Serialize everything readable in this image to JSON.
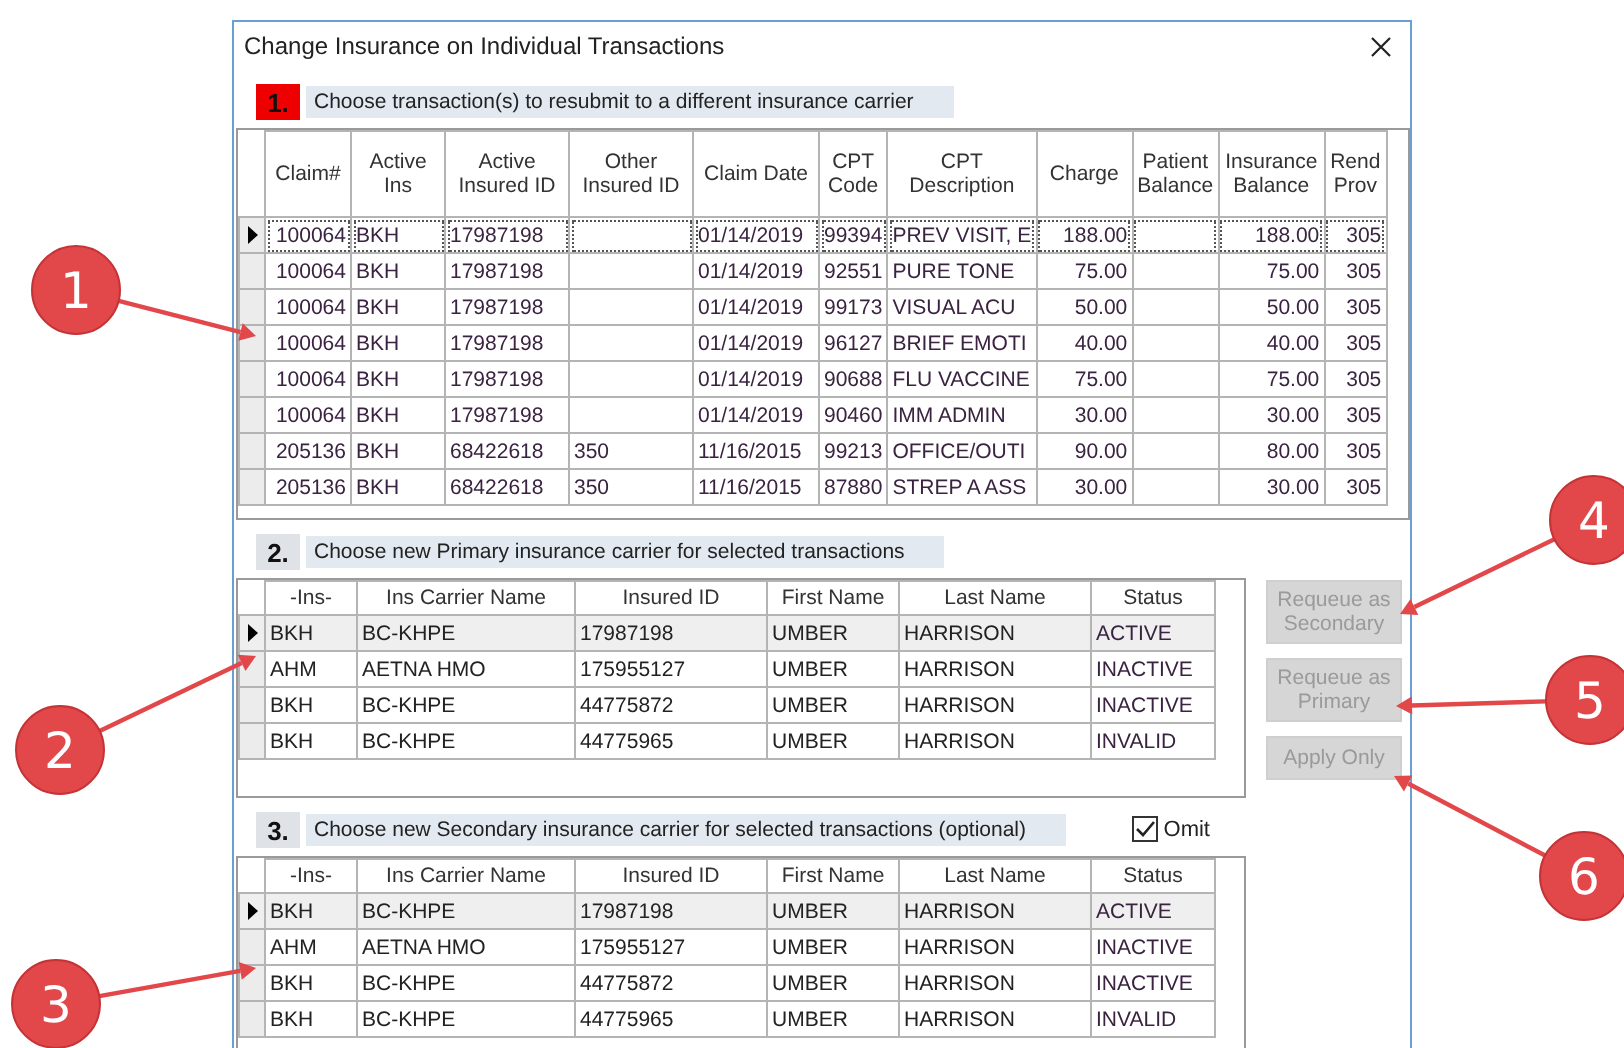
{
  "window": {
    "title": "Change Insurance on Individual Transactions"
  },
  "transactions": {
    "number": "1.",
    "highlighted": true,
    "heading": "Choose transaction(s) to resubmit to a different insurance carrier",
    "columns": [
      {
        "label": "Claim#",
        "kind": "number"
      },
      {
        "label": "Active Ins",
        "kind": "text"
      },
      {
        "label": "Active Insured ID",
        "kind": "text"
      },
      {
        "label": "Other Insured ID",
        "kind": "text"
      },
      {
        "label": "Claim Date",
        "kind": "text"
      },
      {
        "label": "CPT Code",
        "kind": "text"
      },
      {
        "label": "CPT Description",
        "kind": "text"
      },
      {
        "label": "Charge",
        "kind": "number"
      },
      {
        "label": "Patient Balance",
        "kind": "number"
      },
      {
        "label": "Insurance Balance",
        "kind": "number"
      },
      {
        "label": "Rend Prov",
        "kind": "number"
      }
    ],
    "rows": [
      {
        "selected": true,
        "cells": [
          "100064",
          "BKH",
          "17987198",
          "",
          "01/14/2019",
          "99394",
          "PREV VISIT, E",
          "188.00",
          "",
          "188.00",
          "305"
        ]
      },
      {
        "selected": false,
        "cells": [
          "100064",
          "BKH",
          "17987198",
          "",
          "01/14/2019",
          "92551",
          "PURE TONE",
          "75.00",
          "",
          "75.00",
          "305"
        ]
      },
      {
        "selected": false,
        "cells": [
          "100064",
          "BKH",
          "17987198",
          "",
          "01/14/2019",
          "99173",
          "VISUAL ACU",
          "50.00",
          "",
          "50.00",
          "305"
        ]
      },
      {
        "selected": false,
        "cells": [
          "100064",
          "BKH",
          "17987198",
          "",
          "01/14/2019",
          "96127",
          "BRIEF EMOTI",
          "40.00",
          "",
          "40.00",
          "305"
        ]
      },
      {
        "selected": false,
        "cells": [
          "100064",
          "BKH",
          "17987198",
          "",
          "01/14/2019",
          "90688",
          "FLU VACCINE",
          "75.00",
          "",
          "75.00",
          "305"
        ]
      },
      {
        "selected": false,
        "cells": [
          "100064",
          "BKH",
          "17987198",
          "",
          "01/14/2019",
          "90460",
          "IMM ADMIN",
          "30.00",
          "",
          "30.00",
          "305"
        ]
      },
      {
        "selected": false,
        "cells": [
          "205136",
          "BKH",
          "68422618",
          "350",
          "11/16/2015",
          "99213",
          "OFFICE/OUTI",
          "90.00",
          "",
          "80.00",
          "305"
        ]
      },
      {
        "selected": false,
        "cells": [
          "205136",
          "BKH",
          "68422618",
          "350",
          "11/16/2015",
          "87880",
          "STREP A ASS",
          "30.00",
          "",
          "30.00",
          "305"
        ]
      }
    ]
  },
  "primary": {
    "number": "2.",
    "highlighted": false,
    "heading": "Choose new Primary insurance carrier for selected transactions",
    "columns": [
      {
        "label": "-Ins-"
      },
      {
        "label": "Ins Carrier Name"
      },
      {
        "label": "Insured ID"
      },
      {
        "label": "First Name"
      },
      {
        "label": "Last Name"
      },
      {
        "label": "Status"
      }
    ],
    "rows": [
      {
        "selected": true,
        "cells": [
          "BKH",
          "BC-KHPE",
          "17987198",
          "UMBER",
          "HARRISON",
          "ACTIVE"
        ]
      },
      {
        "selected": false,
        "cells": [
          "AHM",
          "AETNA HMO",
          "175955127",
          "UMBER",
          "HARRISON",
          "INACTIVE"
        ]
      },
      {
        "selected": false,
        "cells": [
          "BKH",
          "BC-KHPE",
          "44775872",
          "UMBER",
          "HARRISON",
          "INACTIVE"
        ]
      },
      {
        "selected": false,
        "cells": [
          "BKH",
          "BC-KHPE",
          "44775965",
          "UMBER",
          "HARRISON",
          "INVALID"
        ]
      }
    ]
  },
  "secondary": {
    "number": "3.",
    "highlighted": false,
    "heading": "Choose new Secondary insurance carrier for selected transactions (optional)",
    "omit": {
      "label": "Omit",
      "checked": true
    },
    "columns": [
      {
        "label": "-Ins-"
      },
      {
        "label": "Ins Carrier Name"
      },
      {
        "label": "Insured ID"
      },
      {
        "label": "First Name"
      },
      {
        "label": "Last Name"
      },
      {
        "label": "Status"
      }
    ],
    "rows": [
      {
        "selected": true,
        "cells": [
          "BKH",
          "BC-KHPE",
          "17987198",
          "UMBER",
          "HARRISON",
          "ACTIVE"
        ]
      },
      {
        "selected": false,
        "cells": [
          "AHM",
          "AETNA HMO",
          "175955127",
          "UMBER",
          "HARRISON",
          "INACTIVE"
        ]
      },
      {
        "selected": false,
        "cells": [
          "BKH",
          "BC-KHPE",
          "44775872",
          "UMBER",
          "HARRISON",
          "INACTIVE"
        ]
      },
      {
        "selected": false,
        "cells": [
          "BKH",
          "BC-KHPE",
          "44775965",
          "UMBER",
          "HARRISON",
          "INVALID"
        ]
      }
    ]
  },
  "buttons": [
    {
      "label": "Requeue as Secondary",
      "disabled": true
    },
    {
      "label": "Requeue as Primary",
      "disabled": true
    },
    {
      "label": "Apply Only",
      "disabled": true
    }
  ],
  "callouts": [
    {
      "number": "1"
    },
    {
      "number": "2"
    },
    {
      "number": "3"
    },
    {
      "number": "4"
    },
    {
      "number": "5"
    },
    {
      "number": "6"
    }
  ]
}
